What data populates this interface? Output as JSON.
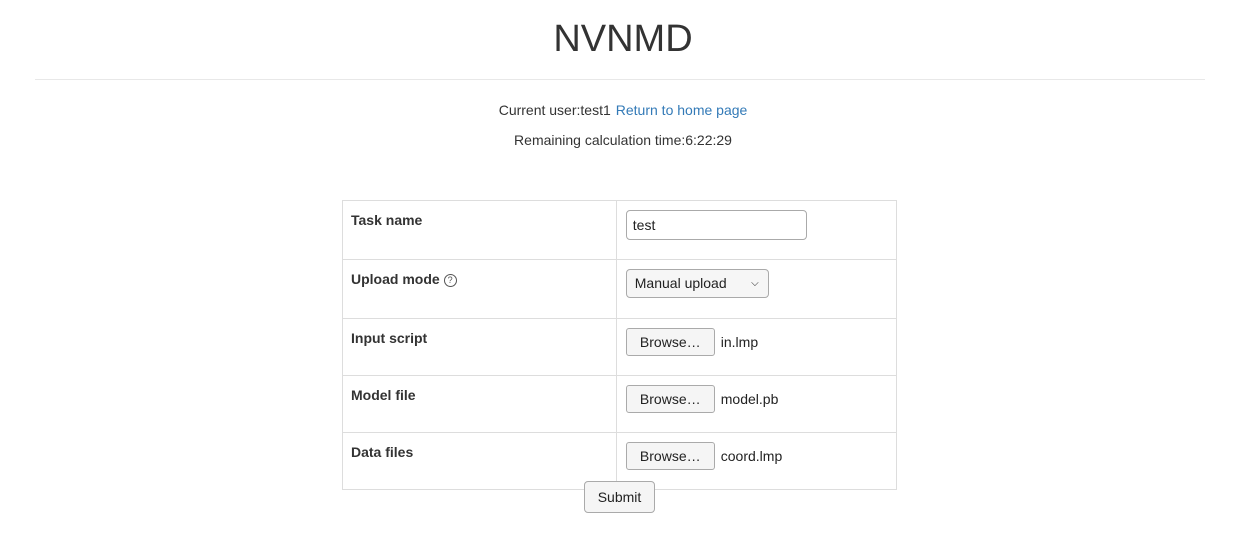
{
  "header": {
    "title": "NVNMD"
  },
  "user": {
    "label": "Current user:test1",
    "home_link": "Return to home page"
  },
  "time": {
    "label": "Remaining calculation time:6:22:29"
  },
  "form": {
    "task_name": {
      "label": "Task name",
      "value": "test"
    },
    "upload_mode": {
      "label": "Upload mode",
      "help_icon": "help-circle-icon",
      "selected": "Manual upload"
    },
    "input_script": {
      "label": "Input script",
      "button": "Browse…",
      "file": "in.lmp"
    },
    "model_file": {
      "label": "Model file",
      "button": "Browse…",
      "file": "model.pb"
    },
    "data_files": {
      "label": "Data files",
      "button": "Browse…",
      "file": "coord.lmp"
    }
  },
  "actions": {
    "submit": "Submit"
  }
}
